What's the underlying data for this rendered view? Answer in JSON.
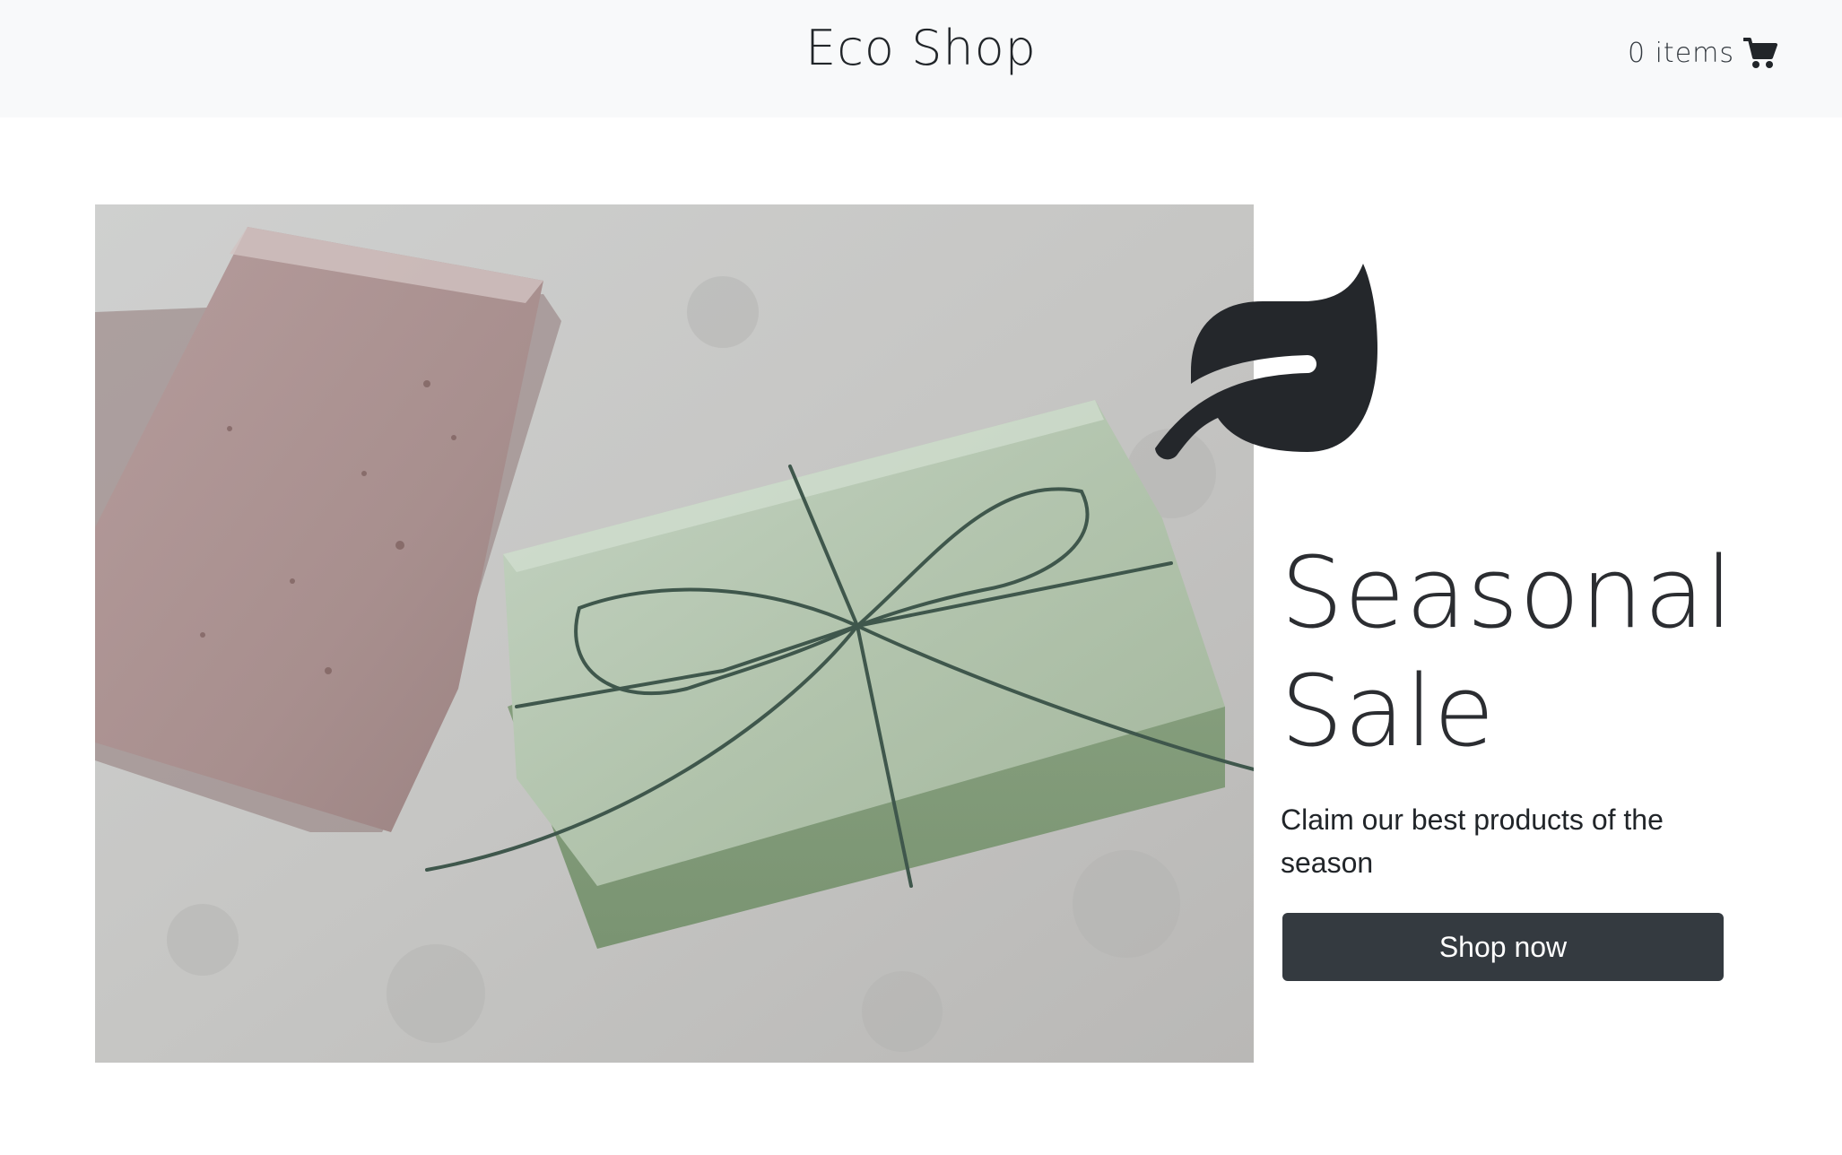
{
  "navbar": {
    "brand": "Eco Shop",
    "cart_count_text": "0 items",
    "cart_icon": "shopping-cart-icon"
  },
  "hero": {
    "image_subject": "soap-bars-photo",
    "icon": "leaf-icon",
    "headline": "Seasonal Sale",
    "subtext": "Claim our best products of the season",
    "cta_label": "Shop now"
  },
  "colors": {
    "navbar_bg": "#f8f9fa",
    "text_dark": "#212529",
    "button_bg": "#343a40",
    "button_text": "#ffffff",
    "leaf": "#24272b"
  }
}
